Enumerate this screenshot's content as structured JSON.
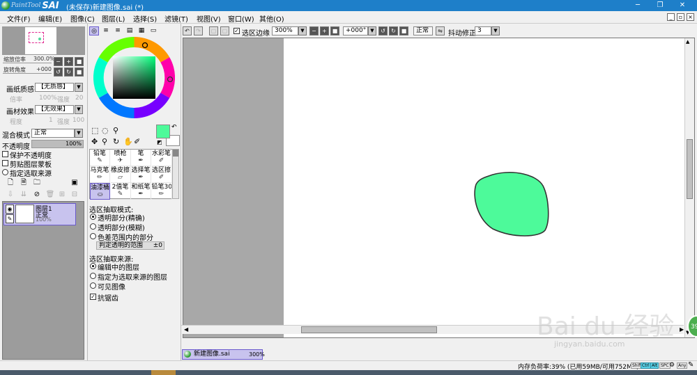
{
  "titlebar": {
    "logo_small": "PaintTool",
    "logo_big": "SAI",
    "title": "(未保存)新建图像.sai (*)",
    "min": "─",
    "restore": "❐",
    "close": "✕"
  },
  "menu": {
    "items": [
      "文件(F)",
      "编辑(E)",
      "图像(C)",
      "图层(L)",
      "选择(S)",
      "滤镜(T)",
      "视图(V)",
      "窗口(W)",
      "其他(O)"
    ]
  },
  "navigator": {
    "zoom_label": "缩放倍率",
    "zoom_value": "300.0%",
    "rotate_label": "旋转角度",
    "rotate_value": "+000"
  },
  "layer_props": {
    "paper_texture_label": "画纸质感",
    "paper_texture_value": "【无质感】",
    "ratio_label": "倍率",
    "ratio_value": "100%",
    "strength_label": "强度",
    "strength_value": "20",
    "material_label": "画材效果",
    "material_value": "【无效果】",
    "degree_label": "程度",
    "degree_value": "1",
    "strength2_label": "强度",
    "strength2_value": "100",
    "blend_label": "混合模式",
    "blend_value": "正常",
    "opacity_label": "不透明度",
    "opacity_value": "100%",
    "opt_protect": "保护不透明度",
    "opt_clip": "剪贴图层蒙板",
    "opt_source": "指定选取来源"
  },
  "layer": {
    "name": "图层1",
    "mode": "正常",
    "opacity": "100%"
  },
  "color": {
    "current": "#4dfa9a",
    "secondary": "#ffffff"
  },
  "tools": [
    {
      "label": "铅笔",
      "glyph": "✎"
    },
    {
      "label": "喷枪",
      "glyph": "✈"
    },
    {
      "label": "笔",
      "glyph": "✒"
    },
    {
      "label": "水彩笔",
      "glyph": "✐"
    },
    {
      "label": "马克笔",
      "glyph": "✏"
    },
    {
      "label": "橡皮擦",
      "glyph": "▱"
    },
    {
      "label": "选择笔",
      "glyph": "✒"
    },
    {
      "label": "选区擦",
      "glyph": "✐"
    },
    {
      "label": "油漆桶",
      "glyph": "⛀"
    },
    {
      "label": "2值笔",
      "glyph": "✎"
    },
    {
      "label": "和纸笔",
      "glyph": "✒"
    },
    {
      "label": "铅笔30",
      "glyph": "✏"
    }
  ],
  "tool_options": {
    "mode_title": "选区抽取模式:",
    "mode_opt1": "透明部分(精确)",
    "mode_opt2": "透明部分(模糊)",
    "mode_opt3": "色差范围内的部分",
    "range_label": "判定透明的范围",
    "range_value": "±0",
    "source_title": "选区抽取来源:",
    "source_opt1": "编辑中的图层",
    "source_opt2": "指定为选取来源的图层",
    "source_opt3": "可见图像",
    "antialias": "抗锯齿"
  },
  "canvas_toolbar": {
    "sel_edge": "选区边缘",
    "zoom": "300%",
    "angle": "+000°",
    "mode": "正常",
    "stab_label": "抖动修正",
    "stab_value": "3"
  },
  "doc_tab": {
    "name": "新建图像.sai",
    "zoom": "300%"
  },
  "status": {
    "memory": "内存负荷率:39% (已用59MB/可用752MB)",
    "keys": [
      "Shift",
      "Ctrl",
      "Alt",
      "SPC",
      "Any"
    ]
  },
  "watermark": {
    "text": "Bai du 经验",
    "url": "jingyan.baidu.com",
    "badge": "39"
  }
}
